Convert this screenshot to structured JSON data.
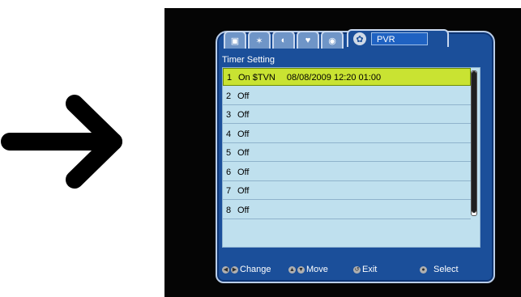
{
  "osd": {
    "tabs": [
      {
        "icon_name": "picture-icon",
        "glyph": "▣"
      },
      {
        "icon_name": "satellite-icon",
        "glyph": "✶"
      },
      {
        "icon_name": "channel-icon",
        "glyph": "◐"
      },
      {
        "icon_name": "favorite-icon",
        "glyph": "♥"
      },
      {
        "icon_name": "lock-icon",
        "glyph": "◉"
      }
    ],
    "active_tab": {
      "icon_name": "pvr-icon",
      "glyph": "✿",
      "label": "PVR"
    },
    "section_title": "Timer Setting",
    "timers": [
      {
        "num": "1",
        "status": "On $TVN",
        "detail": "08/08/2009 12:20 01:00"
      },
      {
        "num": "2",
        "status": "Off",
        "detail": ""
      },
      {
        "num": "3",
        "status": "Off",
        "detail": ""
      },
      {
        "num": "4",
        "status": "Off",
        "detail": ""
      },
      {
        "num": "5",
        "status": "Off",
        "detail": ""
      },
      {
        "num": "6",
        "status": "Off",
        "detail": ""
      },
      {
        "num": "7",
        "status": "Off",
        "detail": ""
      },
      {
        "num": "8",
        "status": "Off",
        "detail": ""
      }
    ],
    "footer": {
      "change": "Change",
      "move": "Move",
      "exit": "Exit",
      "select": "Select"
    }
  },
  "colors": {
    "panel": "#1b4f9a",
    "list": "#bfe0ee",
    "highlight": "#c9e332"
  }
}
